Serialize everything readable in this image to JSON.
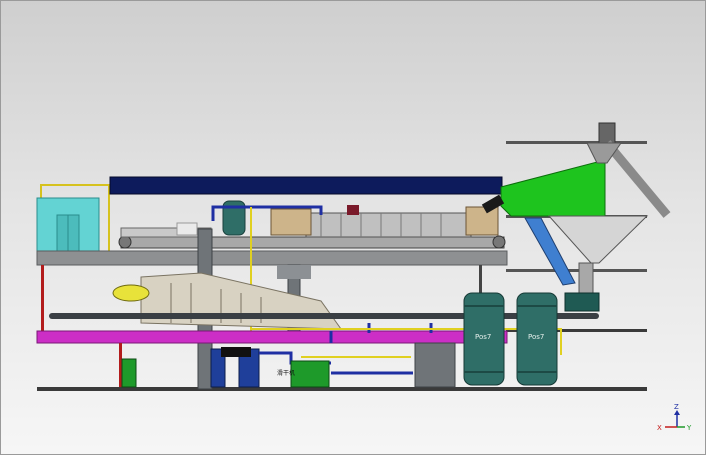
{
  "labels": {
    "tank_left": "Pos7",
    "tank_right": "Pos7",
    "control_box": "滑干机"
  },
  "axes": {
    "z": "Z",
    "x": "X",
    "y": "Y"
  },
  "colors": {
    "background_top": "#cfcfcf",
    "background_bottom": "#f6f6f6",
    "canopy": "#0d1b5c",
    "conveyor_frame": "#8e9092",
    "hopper_green": "#1ec41e",
    "cyan_cabin": "#63d3d3",
    "magenta_beam": "#cc2ec6",
    "tank_teal": "#2f6e67",
    "pipe_blue": "#1f2fa3",
    "pipe_yellow": "#e0d020",
    "column_gray": "#6f7478",
    "blue_chute": "#3f7fd0",
    "yellow_motor": "#e8e23a"
  }
}
